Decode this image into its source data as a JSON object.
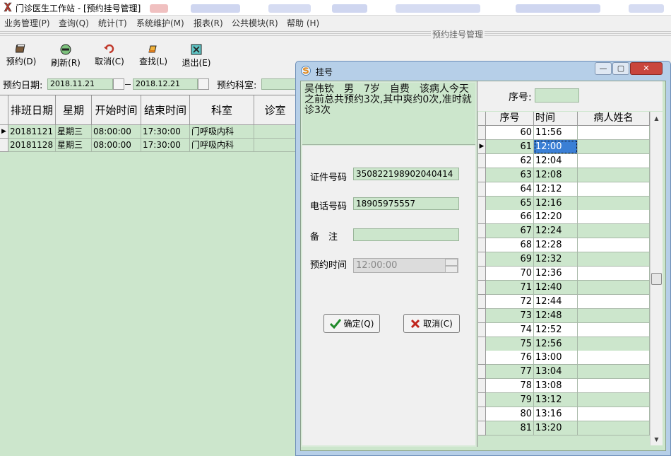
{
  "window": {
    "title": "门诊医生工作站 - [预约挂号管理]"
  },
  "menu": [
    {
      "label": "业务管理(P)"
    },
    {
      "label": "查询(Q)"
    },
    {
      "label": "统计(T)"
    },
    {
      "label": "系统维护(M)"
    },
    {
      "label": "报表(R)"
    },
    {
      "label": "公共模块(R)"
    },
    {
      "label": "帮助 (H)"
    }
  ],
  "module_title": "预约挂号管理",
  "toolbar": {
    "reserve": "预约(D)",
    "refresh": "刷新(R)",
    "cancel": "取消(C)",
    "find": "查找(L)",
    "exit": "退出(E)"
  },
  "filter": {
    "date_label": "预约日期:",
    "date_from": "2018.11.21",
    "date_to": "2018.12.21",
    "dept_label": "预约科室:"
  },
  "schedule": {
    "columns": [
      "排班日期",
      "星期",
      "开始时间",
      "结束时间",
      "科室",
      "诊室"
    ],
    "rows": [
      {
        "date": "20181121",
        "weekday": "星期三",
        "start": "08:00:00",
        "end": "17:30:00",
        "dept": "门呼吸内科",
        "room": ""
      },
      {
        "date": "20181128",
        "weekday": "星期三",
        "start": "08:00:00",
        "end": "17:30:00",
        "dept": "门呼吸内科",
        "room": ""
      }
    ]
  },
  "dialog": {
    "title": "挂号",
    "info": "吴伟钦　男　7岁　自费　该病人今天之前总共预约3次,其中爽约0次,准时就诊3次",
    "fields": {
      "id_label": "证件号码",
      "id_value": "350822198902040414",
      "phone_label": "电话号码",
      "phone_value": "18905975557",
      "note_label": "备　注",
      "note_value": "",
      "time_label": "预约时间",
      "time_value": "12:00:00"
    },
    "ok_label": "确定(Q)",
    "cancel_label": "取消(C)",
    "seq_label": "序号:",
    "seq_value": "",
    "slots": {
      "columns": [
        "序号",
        "时间",
        "病人姓名"
      ],
      "rows": [
        {
          "no": "60",
          "time": "11:56",
          "name": ""
        },
        {
          "no": "61",
          "time": "12:00",
          "name": ""
        },
        {
          "no": "62",
          "time": "12:04",
          "name": ""
        },
        {
          "no": "63",
          "time": "12:08",
          "name": ""
        },
        {
          "no": "64",
          "time": "12:12",
          "name": ""
        },
        {
          "no": "65",
          "time": "12:16",
          "name": ""
        },
        {
          "no": "66",
          "time": "12:20",
          "name": ""
        },
        {
          "no": "67",
          "time": "12:24",
          "name": ""
        },
        {
          "no": "68",
          "time": "12:28",
          "name": ""
        },
        {
          "no": "69",
          "time": "12:32",
          "name": ""
        },
        {
          "no": "70",
          "time": "12:36",
          "name": ""
        },
        {
          "no": "71",
          "time": "12:40",
          "name": ""
        },
        {
          "no": "72",
          "time": "12:44",
          "name": ""
        },
        {
          "no": "73",
          "time": "12:48",
          "name": ""
        },
        {
          "no": "74",
          "time": "12:52",
          "name": ""
        },
        {
          "no": "75",
          "time": "12:56",
          "name": ""
        },
        {
          "no": "76",
          "time": "13:00",
          "name": ""
        },
        {
          "no": "77",
          "time": "13:04",
          "name": ""
        },
        {
          "no": "78",
          "time": "13:08",
          "name": ""
        },
        {
          "no": "79",
          "time": "13:12",
          "name": ""
        },
        {
          "no": "80",
          "time": "13:16",
          "name": ""
        },
        {
          "no": "81",
          "time": "13:20",
          "name": ""
        }
      ]
    }
  },
  "colors": {
    "grid_green": "#cce6cc",
    "row_alt": "#ffffff",
    "selection": "#3a7fd5",
    "dialog_frame": "#b6cfe8",
    "close_red": "#c9463d"
  }
}
